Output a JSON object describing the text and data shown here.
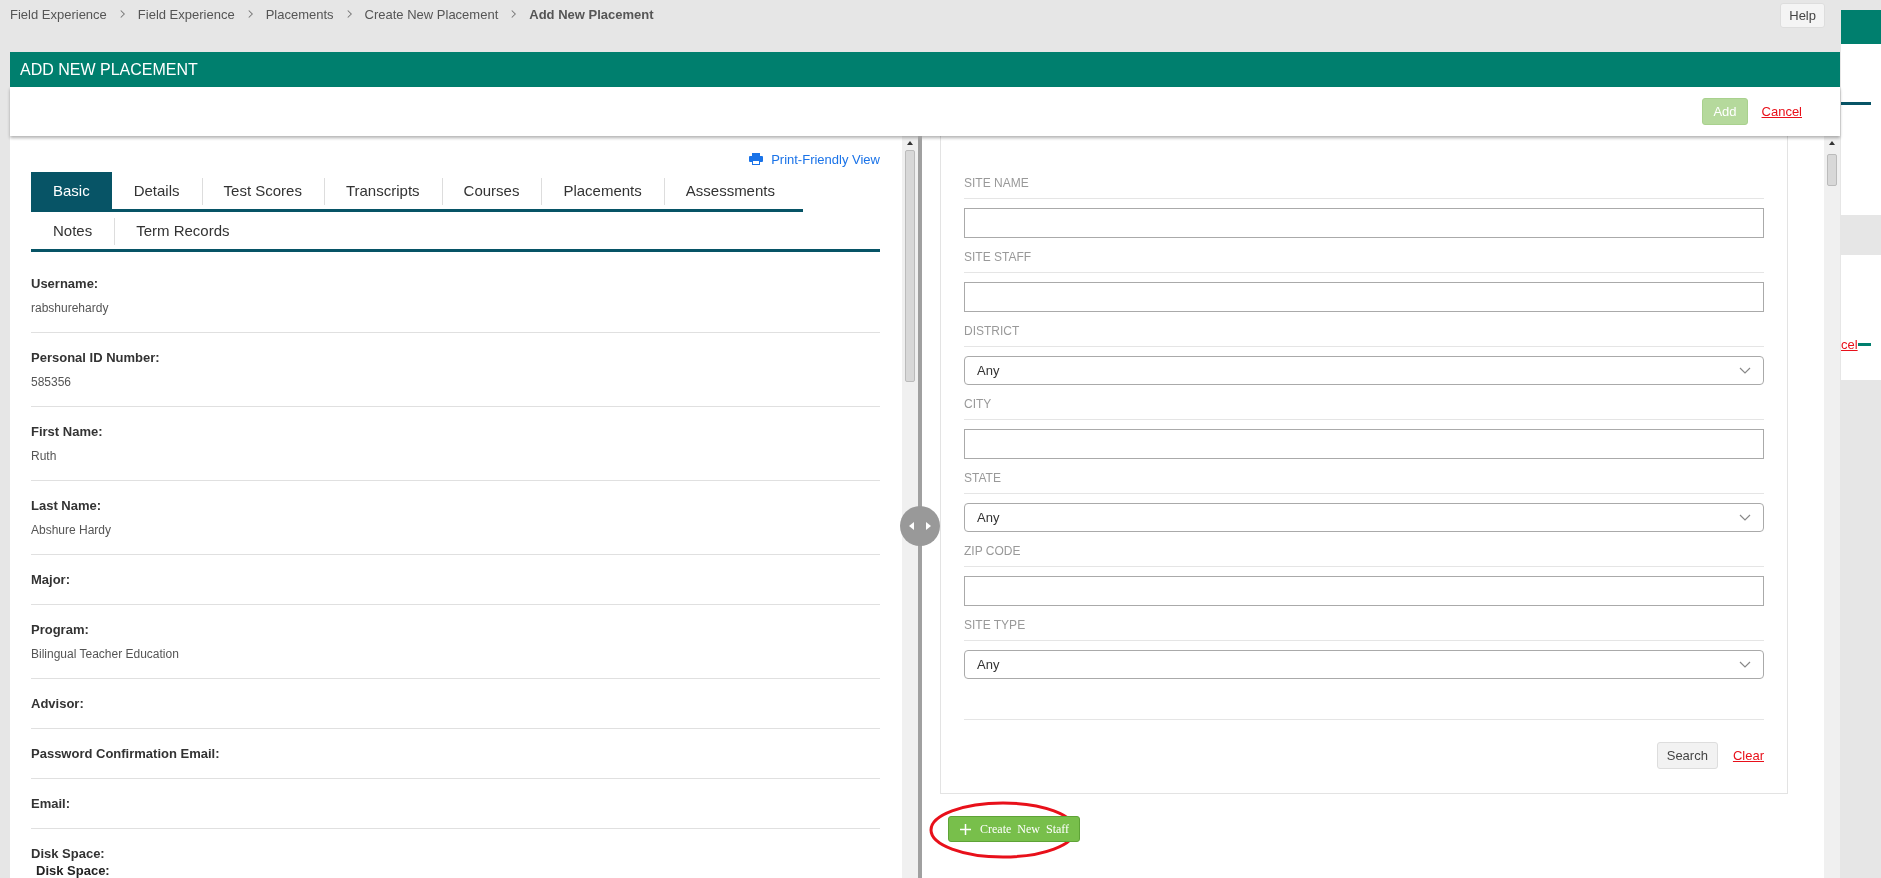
{
  "breadcrumb": [
    {
      "label": "Field Experience",
      "current": false
    },
    {
      "label": "Field Experience",
      "current": false
    },
    {
      "label": "Placements",
      "current": false
    },
    {
      "label": "Create New Placement",
      "current": false
    },
    {
      "label": "Add New Placement",
      "current": true
    }
  ],
  "help_button": "Help",
  "modal": {
    "title": "ADD NEW PLACEMENT",
    "add_button": {
      "label": "Add",
      "disabled": true
    },
    "cancel_link": "Cancel"
  },
  "print_link": "Print-Friendly View",
  "tab_rows": [
    [
      {
        "label": "Basic",
        "selected": true
      },
      {
        "label": "Details",
        "selected": false
      },
      {
        "label": "Test Scores",
        "selected": false
      },
      {
        "label": "Transcripts",
        "selected": false
      },
      {
        "label": "Courses",
        "selected": false
      },
      {
        "label": "Placements",
        "selected": false
      },
      {
        "label": "Assessments",
        "selected": false
      }
    ],
    [
      {
        "label": "Notes",
        "selected": false
      },
      {
        "label": "Term Records",
        "selected": false
      }
    ]
  ],
  "fields": [
    {
      "label": "Username:",
      "value": "rabshurehardy"
    },
    {
      "label": "Personal ID Number:",
      "value": "585356"
    },
    {
      "label": "First Name:",
      "value": "Ruth"
    },
    {
      "label": "Last Name:",
      "value": "Abshure Hardy"
    },
    {
      "label": "Major:"
    },
    {
      "label": "Program:",
      "value": "Bilingual Teacher Education"
    },
    {
      "label": "Advisor:"
    },
    {
      "label": "Password Confirmation Email:"
    },
    {
      "label": "Email:"
    },
    {
      "label": "Disk Space:"
    }
  ],
  "overlay_label": "Disk Space:",
  "search_form": [
    {
      "label": "SITE NAME",
      "kind": "text"
    },
    {
      "label": "SITE STAFF",
      "kind": "text"
    },
    {
      "label": "DISTRICT",
      "kind": "select",
      "value": "Any"
    },
    {
      "label": "CITY",
      "kind": "text"
    },
    {
      "label": "STATE",
      "kind": "select",
      "value": "Any"
    },
    {
      "label": "ZIP CODE",
      "kind": "text"
    },
    {
      "label": "SITE TYPE",
      "kind": "select",
      "value": "Any"
    }
  ],
  "search_button": "Search",
  "clear_link": "Clear",
  "create_staff_button": "Create New Staff",
  "background_link": "cel"
}
